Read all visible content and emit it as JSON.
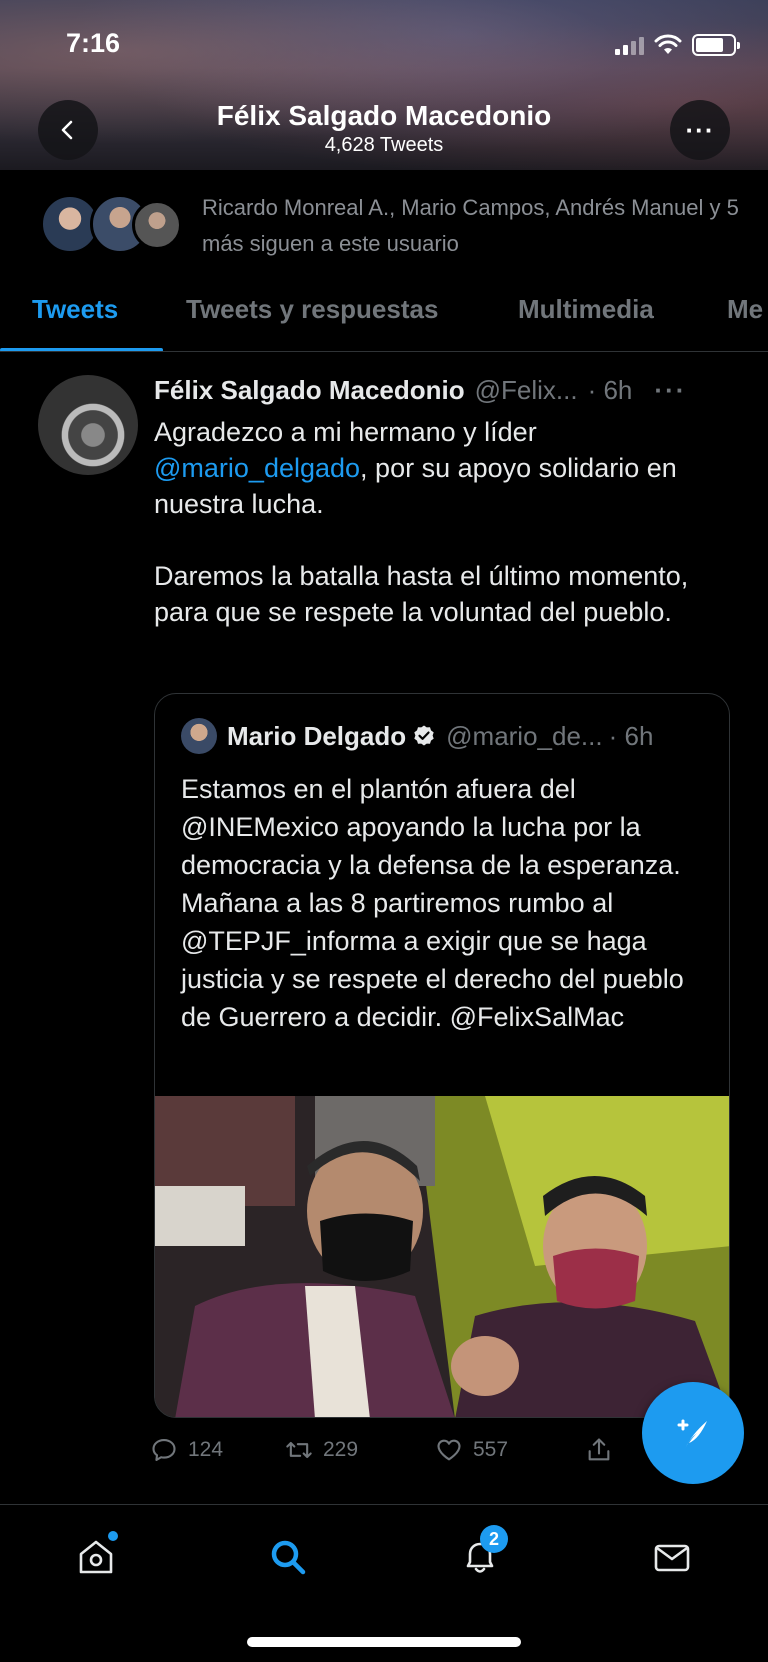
{
  "status_bar": {
    "time": "7:16"
  },
  "profile": {
    "name": "Félix Salgado Macedonio",
    "tweet_count": "4,628 Tweets"
  },
  "followed_by": {
    "text": "Ricardo Monreal A., Mario Campos, Andrés Manuel y 5 más siguen a este usuario"
  },
  "tabs": [
    {
      "label": "Tweets"
    },
    {
      "label": "Tweets y respuestas"
    },
    {
      "label": "Multimedia"
    },
    {
      "label": "Me"
    }
  ],
  "tweet": {
    "author_name": "Félix Salgado Macedonio",
    "handle": "@Felix...",
    "time": "· 6h",
    "more": "···",
    "text_part1": "Agradezco a mi hermano y líder ",
    "mention": "@mario_delgado",
    "text_part2": ", por su apoyo solidario en nuestra lucha.",
    "text_paragraph2": "Daremos la batalla hasta el último momento, para que se respete la voluntad del pueblo.",
    "quote": {
      "author_name": "Mario Delgado",
      "handle": "@mario_de...",
      "time": "· 6h",
      "text": "Estamos en el plantón afuera del @INEMexico apoyando la lucha por la democracia y la defensa de la esperanza. Mañana a las 8 partiremos rumbo al @TEPJF_informa a exigir que se haga justicia y se respete el derecho del pueblo de Guerrero a decidir. @FelixSalMac"
    },
    "actions": {
      "replies": "124",
      "retweets": "229",
      "likes": "557"
    }
  },
  "bottom_nav": {
    "notifications_badge": "2"
  },
  "colors": {
    "accent": "#1d9bf0",
    "background": "#000000",
    "muted": "#71767b"
  },
  "icons": [
    "back-icon",
    "more-icon",
    "reply-icon",
    "retweet-icon",
    "like-icon",
    "share-icon",
    "compose-icon",
    "home-icon",
    "search-icon",
    "notifications-icon",
    "messages-icon"
  ]
}
